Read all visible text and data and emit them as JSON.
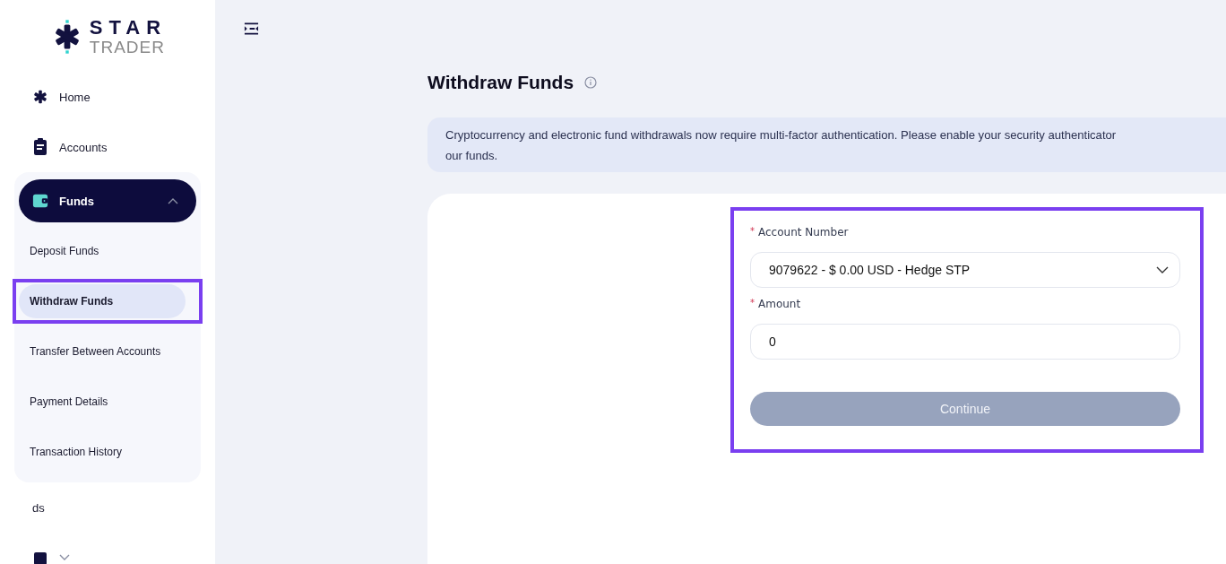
{
  "logo": {
    "line_1": "STAR",
    "line_2": "TRADER"
  },
  "sidebar": {
    "items": [
      {
        "label": "Home",
        "kind": "home",
        "selected": false
      },
      {
        "label": "Accounts",
        "kind": "accounts",
        "selected": false
      },
      {
        "label": "Funds",
        "kind": "funds",
        "selected": true,
        "expanded": true,
        "children": [
          {
            "label": "Deposit Funds",
            "selected": false,
            "highlighted": false
          },
          {
            "label": "Withdraw Funds",
            "selected": true,
            "highlighted": true
          },
          {
            "label": "Transfer Between Accounts",
            "selected": false,
            "highlighted": false
          },
          {
            "label": "Payment Details",
            "selected": false,
            "highlighted": false
          },
          {
            "label": "Transaction History",
            "selected": false,
            "highlighted": false
          }
        ]
      },
      {
        "label": "ds",
        "kind": "plain",
        "selected": false
      },
      {
        "kind": "cut",
        "selected": false,
        "expanded": false
      }
    ]
  },
  "page": {
    "title": "Withdraw Funds",
    "notice": [
      "Cryptocurrency and electronic fund withdrawals now require multi-factor authentication. Please enable your security authenticator",
      "our funds."
    ],
    "form": {
      "highlighted": true,
      "fields": [
        {
          "label": "Account Number",
          "required_mark": "*",
          "kind": "select",
          "value": "9079622 - $ 0.00 USD - Hedge STP"
        },
        {
          "label": "Amount",
          "required_mark": "*",
          "kind": "input",
          "value": "0"
        }
      ],
      "submit": {
        "label": "Continue",
        "disabled": true
      }
    }
  }
}
